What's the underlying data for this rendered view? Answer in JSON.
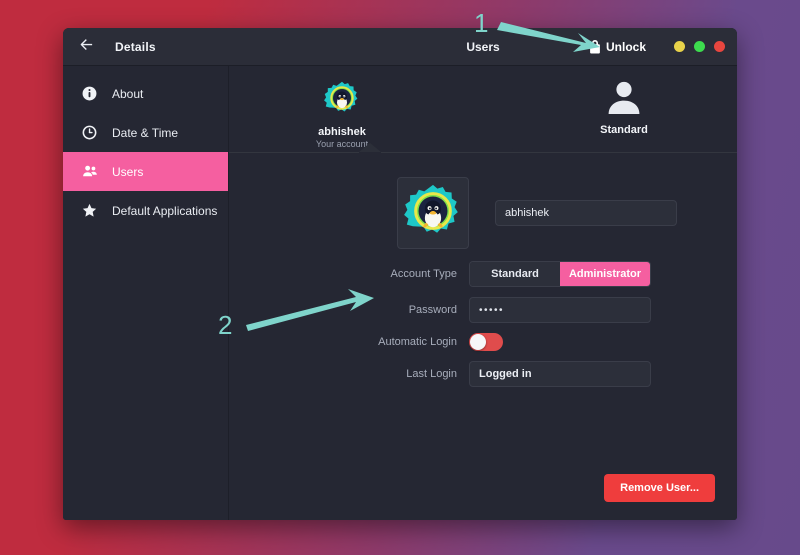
{
  "window": {
    "titlebar": {
      "back_icon": "back-arrow-icon",
      "left_title": "Details",
      "main_title": "Users",
      "unlock_label": "Unlock",
      "unlock_icon": "lock-open-icon",
      "controls": [
        {
          "name": "minimize",
          "color": "#e8d24a"
        },
        {
          "name": "maximize",
          "color": "#3ddb4e"
        },
        {
          "name": "close",
          "color": "#e8463f"
        }
      ]
    },
    "sidebar": {
      "items": [
        {
          "label": "About",
          "icon": "info-icon",
          "active": false
        },
        {
          "label": "Date & Time",
          "icon": "clock-icon",
          "active": false
        },
        {
          "label": "Users",
          "icon": "users-icon",
          "active": true
        },
        {
          "label": "Default Applications",
          "icon": "star-icon",
          "active": false
        }
      ],
      "active_color": "#f55fa0"
    },
    "carousel": {
      "users": [
        {
          "name": "abhishek",
          "subtitle": "Your account",
          "avatar": "tux-gear-avatar-icon",
          "selected": true
        },
        {
          "name": "Standard",
          "subtitle": "",
          "avatar": "person-icon",
          "selected": false
        }
      ]
    },
    "form": {
      "avatar_icon": "tux-gear-avatar-icon",
      "username_value": "abhishek",
      "rows": [
        {
          "label": "Account Type",
          "type": "segmented",
          "options": [
            "Standard",
            "Administrator"
          ],
          "selected": "Administrator"
        },
        {
          "label": "Password",
          "type": "entry",
          "value": "•••••"
        },
        {
          "label": "Automatic Login",
          "type": "switch",
          "value": "off",
          "switch_color": "#e04c4c"
        },
        {
          "label": "Last Login",
          "type": "entry",
          "value": "Logged in"
        }
      ]
    },
    "actions": {
      "remove_user_label": "Remove User...",
      "remove_user_color": "#ef3d3d"
    }
  },
  "annotations": {
    "items": [
      {
        "number": "1",
        "target": "unlock-button",
        "color": "#7fd4cb"
      },
      {
        "number": "2",
        "target": "password-row",
        "color": "#7fd4cb"
      }
    ]
  }
}
